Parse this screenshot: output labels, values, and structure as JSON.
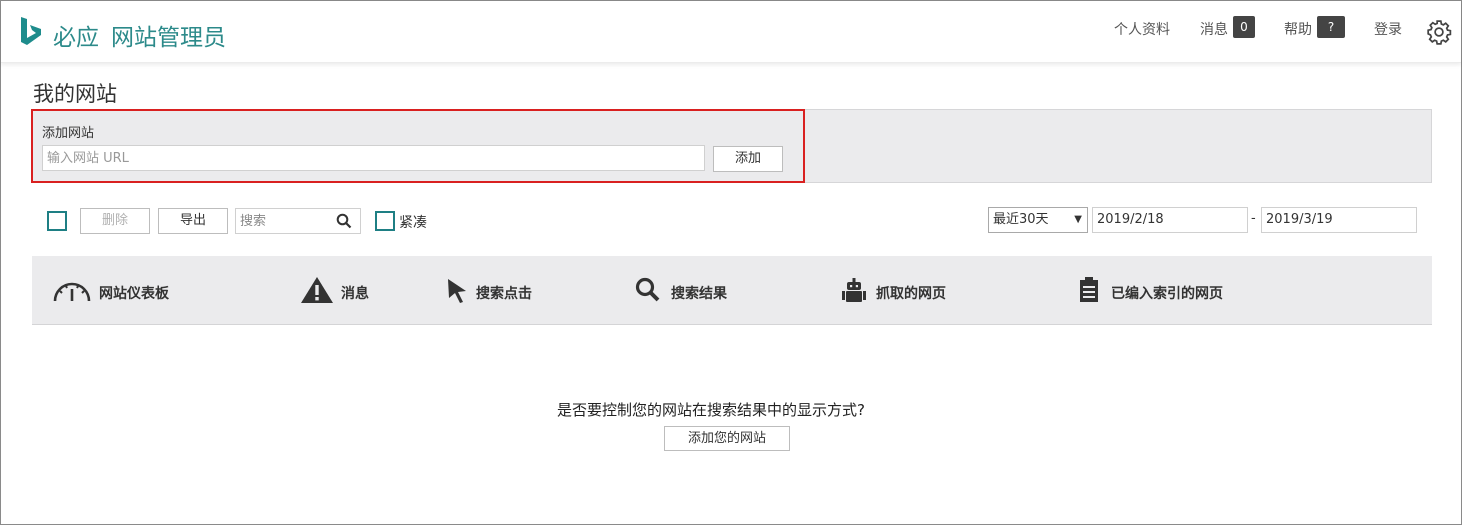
{
  "header": {
    "brand_bing": "必应",
    "brand_product": "网站管理员",
    "profile": "个人资料",
    "messages": "消息",
    "messages_count": "0",
    "help": "帮助",
    "help_badge": "?",
    "login": "登录",
    "accent_color": "#2c8a8a"
  },
  "page": {
    "title": "我的网站"
  },
  "add_site": {
    "label": "添加网站",
    "input_placeholder": "输入网站 URL",
    "input_value": "",
    "button": "添加"
  },
  "toolbar": {
    "delete": "删除",
    "export": "导出",
    "search_placeholder": "搜索",
    "compact": "紧凑",
    "range_selected": "最近30天",
    "date_from": "2019/2/18",
    "date_separator": "-",
    "date_to": "2019/3/19"
  },
  "tabs": [
    {
      "label": "网站仪表板",
      "icon": "gauge-icon"
    },
    {
      "label": "消息",
      "icon": "warning-icon"
    },
    {
      "label": "搜索点击",
      "icon": "cursor-icon"
    },
    {
      "label": "搜索结果",
      "icon": "magnifier-icon"
    },
    {
      "label": "抓取的网页",
      "icon": "robot-icon"
    },
    {
      "label": "已编入索引的网页",
      "icon": "clipboard-icon"
    }
  ],
  "empty_state": {
    "prompt": "是否要控制您的网站在搜索结果中的显示方式?",
    "button": "添加您的网站"
  }
}
